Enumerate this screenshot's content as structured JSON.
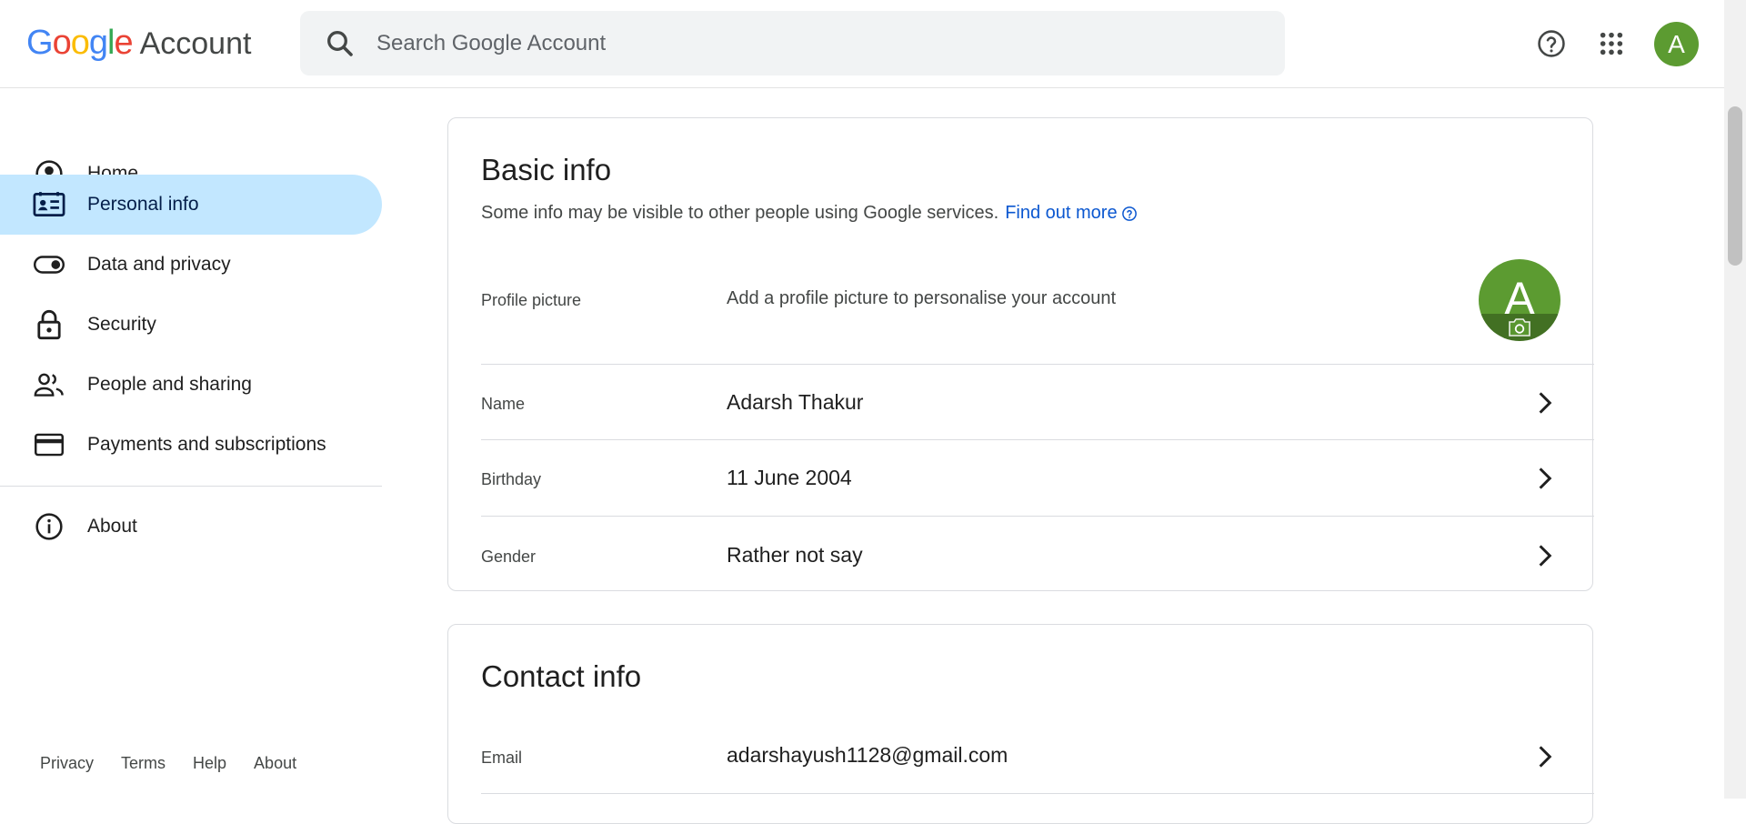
{
  "header": {
    "logo_letters": [
      {
        "ch": "G",
        "color": "#4285f4"
      },
      {
        "ch": "o",
        "color": "#ea4335"
      },
      {
        "ch": "o",
        "color": "#fbbc04"
      },
      {
        "ch": "g",
        "color": "#4285f4"
      },
      {
        "ch": "l",
        "color": "#34a853"
      },
      {
        "ch": "e",
        "color": "#ea4335"
      }
    ],
    "logo_suffix": "Account",
    "search_placeholder": "Search Google Account",
    "avatar_letter": "A",
    "avatar_color": "#5c9b31"
  },
  "sidebar": {
    "items": [
      {
        "label": "Home",
        "icon": "account-circle-icon",
        "active": false
      },
      {
        "label": "Personal info",
        "icon": "id-card-icon",
        "active": true
      },
      {
        "label": "Data and privacy",
        "icon": "toggle-icon",
        "active": false
      },
      {
        "label": "Security",
        "icon": "lock-icon",
        "active": false
      },
      {
        "label": "People and sharing",
        "icon": "people-icon",
        "active": false
      },
      {
        "label": "Payments and subscriptions",
        "icon": "credit-card-icon",
        "active": false
      },
      {
        "label": "About",
        "icon": "info-icon",
        "active": false
      }
    ],
    "footer": [
      "Privacy",
      "Terms",
      "Help",
      "About"
    ]
  },
  "basic_info": {
    "title": "Basic info",
    "subtitle": "Some info may be visible to other people using Google services.",
    "link": "Find out more",
    "profile_picture": {
      "label": "Profile picture",
      "value": "Add a profile picture to personalise your account",
      "letter": "A"
    },
    "rows": [
      {
        "label": "Name",
        "value": "Adarsh Thakur"
      },
      {
        "label": "Birthday",
        "value": "11 June 2004"
      },
      {
        "label": "Gender",
        "value": "Rather not say"
      }
    ]
  },
  "contact_info": {
    "title": "Contact info",
    "rows": [
      {
        "label": "Email",
        "value": "adarshayush1128@gmail.com"
      }
    ]
  },
  "colors": {
    "active_nav": "#c2e7ff",
    "link": "#0b57d0",
    "avatar": "#5c9b31"
  }
}
